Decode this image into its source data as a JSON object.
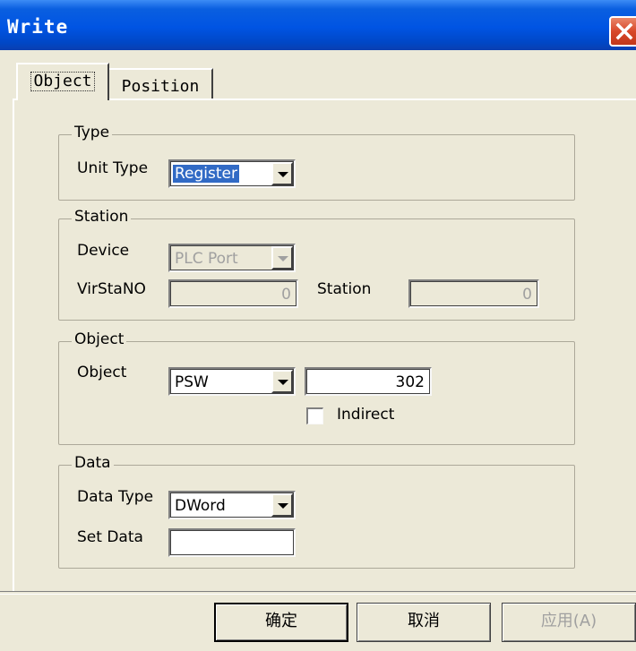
{
  "window": {
    "title": "Write"
  },
  "tabs": [
    {
      "label": "Object",
      "active": true
    },
    {
      "label": "Position",
      "active": false
    }
  ],
  "type_group": {
    "legend": "Type",
    "unit_type_label": "Unit Type",
    "unit_type_value": "Register"
  },
  "station_group": {
    "legend": "Station",
    "device_label": "Device",
    "device_value": "PLC Port",
    "virstano_label": "VirStaNO",
    "virstano_value": "0",
    "station_label": "Station",
    "station_value": "0"
  },
  "object_group": {
    "legend": "Object",
    "object_label": "Object",
    "object_value": "PSW",
    "address_value": "302",
    "indirect_label": "Indirect",
    "indirect_checked": false
  },
  "data_group": {
    "legend": "Data",
    "data_type_label": "Data Type",
    "data_type_value": "DWord",
    "set_data_label": "Set Data",
    "set_data_value": ""
  },
  "buttons": {
    "ok": "确定",
    "cancel": "取消",
    "apply": "应用(A)"
  },
  "colors": {
    "titlebar": "#0054e3",
    "face": "#ece9d8",
    "close": "#d8482a"
  }
}
